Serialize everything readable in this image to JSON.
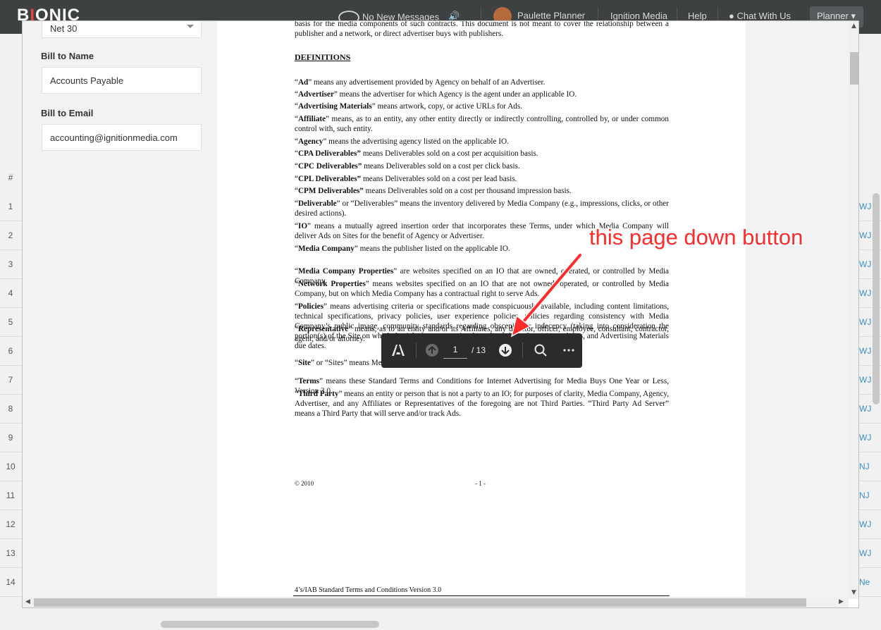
{
  "app": {
    "logo": "BIONIC",
    "messages_label": "No New Messages",
    "user_name": "Paulette Planner",
    "company": "Ignition Media",
    "help": "Help",
    "chat": "Chat With Us",
    "role_menu": "Planner"
  },
  "background_rows": {
    "header": "#",
    "numbers": [
      "1",
      "2",
      "3",
      "4",
      "5",
      "6",
      "7",
      "8",
      "9",
      "10",
      "11",
      "12",
      "13",
      "14"
    ],
    "right_labels": [
      "WJ",
      "WJ",
      "WJ",
      "WJ",
      "WJ",
      "WJ",
      "WJ",
      "WJ",
      "WJ",
      "NJ",
      "NJ",
      "WJ",
      "WJ",
      "Ne"
    ]
  },
  "form": {
    "payment_terms_value": "Net 30",
    "bill_to_name_label": "Bill to Name",
    "bill_to_name_value": "Accounts Payable",
    "bill_to_email_label": "Bill to Email",
    "bill_to_email_value": "accounting@ignitionmedia.com"
  },
  "document": {
    "intro": "basis for the media components of such contracts.  This document is not meant to cover the relationship between a publisher and a network, or direct advertiser buys with publishers.",
    "heading": "DEFINITIONS",
    "definitions": [
      {
        "term": "Ad",
        "text": "” means any advertisement provided by Agency on behalf of an Advertiser."
      },
      {
        "term": "Advertiser",
        "text": "” means the advertiser for which Agency is the agent under an applicable IO."
      },
      {
        "term": "Advertising Materials",
        "text": "” means artwork, copy, or active URLs for Ads."
      },
      {
        "term": "Affiliate",
        "text": "” means, as to an entity, any other entity directly or indirectly controlling, controlled by, or under common control with, such entity."
      },
      {
        "term": "Agency",
        "text": "” means the advertising agency listed on the applicable IO."
      },
      {
        "term": "CPA Deliverables”",
        "text": " means Deliverables sold on a cost per acquisition basis."
      },
      {
        "term": "CPC Deliverables”",
        "text": " means Deliverables sold on a cost per click basis."
      },
      {
        "term": "CPL Deliverables”",
        "text": " means Deliverables sold on a cost per lead basis."
      },
      {
        "term": "CPM Deliverables”",
        "text": " means Deliverables sold on a cost per thousand impression basis."
      },
      {
        "term": "Deliverable",
        "text": "” or “Deliverables” means the inventory delivered by Media Company (e.g., impressions, clicks, or other desired actions)."
      },
      {
        "term": "IO",
        "text": "” means a mutually agreed insertion order that incorporates these Terms, under which Media Company will deliver Ads on Sites for the benefit of Agency or Advertiser."
      },
      {
        "term": "Media Company",
        "text": "” means the publisher listed on the applicable IO."
      },
      {
        "term": "Media Company Properties",
        "text": "” are websites specified on an IO that are owned, operated, or controlled by Media Company."
      },
      {
        "term": "Network Properties",
        "text": "” means websites specified on an IO that are not owned, operated, or controlled by Media Company, but on which Media Company has a contractual right to serve Ads."
      },
      {
        "term": "Policies",
        "text": "” means advertising criteria or specifications made conspicuously available, including content limitations, technical specifications, privacy policies, user experience policies, policies regarding consistency with Media Company’s public image, community standards regarding obscenity or indecency (taking into consideration the portion(s) of the Site on which the Ads are to appear), other editorial or advertising policies, and Advertising Materials due dates."
      },
      {
        "term": "Representative",
        "text": "” means, as to an entity and/or its Affiliates, any director, officer, employee, consultant, contractor, agent, and/or attorney."
      },
      {
        "term": "Site",
        "text": "” or “Sites” means Media Company Properties and Network Properties."
      },
      {
        "term": "Terms",
        "text": "” means these Standard Terms and Conditions for Internet Advertising for Media Buys One Year or Less, Version 3.0."
      },
      {
        "term": "Third Party",
        "text": "” means an entity or person that is not a party to an IO; for purposes of clarity, Media Company, Agency, Advertiser, and any Affiliates or Representatives of the foregoing are not Third Parties. “Third Party Ad Server” means a Third Party that will serve and/or track Ads."
      }
    ],
    "footer_left": "© 2010",
    "footer_page": "- 1 -",
    "footer_bottom": "4’s/IAB Standard Terms and Conditions Version 3.0"
  },
  "pdf_toolbar": {
    "current_page": "1",
    "total_pages": "/ 13",
    "icons": [
      "adobe-icon",
      "page-up-icon",
      "page-down-icon",
      "search-icon",
      "more-icon"
    ]
  },
  "annotation": "this page down button",
  "colors": {
    "annotation": "#ff2a2a",
    "topbar": "#3e4142",
    "toolbar": "#2b2b2b",
    "logo_accent": "#e4443c"
  }
}
